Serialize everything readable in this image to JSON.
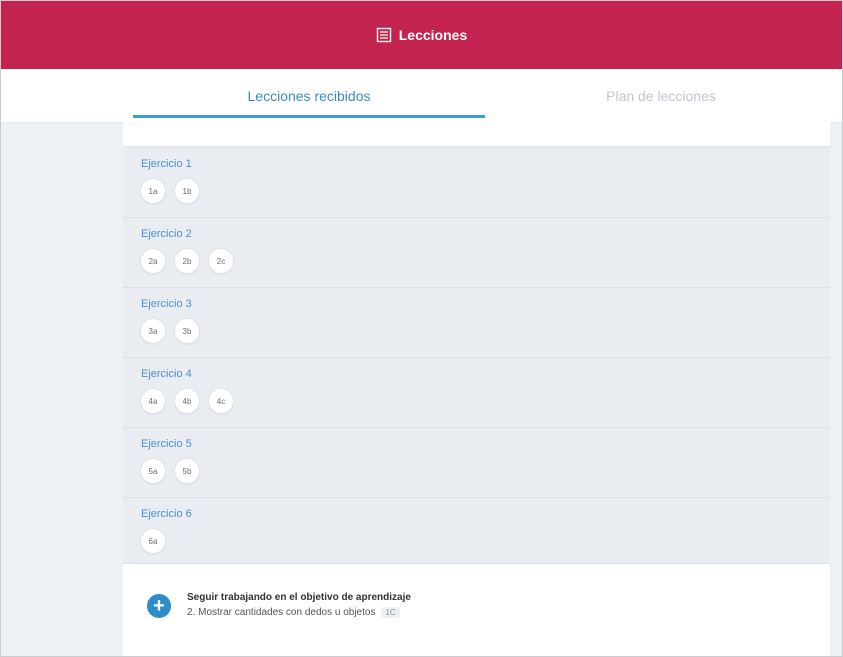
{
  "header": {
    "title": "Lecciones",
    "icon": "list-icon"
  },
  "tabs": [
    {
      "label": "Lecciones recibidos",
      "active": true
    },
    {
      "label": "Plan de lecciones",
      "active": false
    }
  ],
  "exercises": [
    {
      "label": "Ejercicio 1",
      "chips": [
        "1a",
        "1b"
      ]
    },
    {
      "label": "Ejercicio 2",
      "chips": [
        "2a",
        "2b",
        "2c"
      ]
    },
    {
      "label": "Ejercicio 3",
      "chips": [
        "3a",
        "3b"
      ]
    },
    {
      "label": "Ejercicio 4",
      "chips": [
        "4a",
        "4b",
        "4c"
      ]
    },
    {
      "label": "Ejercicio 5",
      "chips": [
        "5a",
        "5b"
      ]
    },
    {
      "label": "Ejercicio 6",
      "chips": [
        "6a"
      ]
    }
  ],
  "footer": {
    "title": "Seguir trabajando en el objetivo de aprendizaje",
    "subtitle": "2. Mostrar cantidades con dedos u objetos",
    "badge": "1C",
    "action_icon": "plus-icon"
  },
  "colors": {
    "header_bg": "#c3234f",
    "accent": "#3a9fd8",
    "link": "#4b8fd0"
  }
}
